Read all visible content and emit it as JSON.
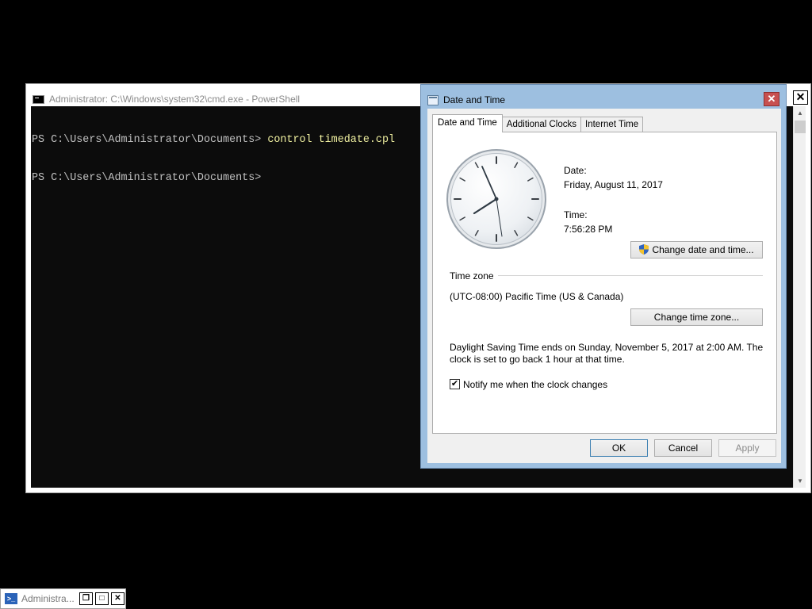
{
  "console": {
    "title": "Administrator: C:\\Windows\\system32\\cmd.exe - PowerShell",
    "lines": [
      {
        "prompt": "PS C:\\Users\\Administrator\\Documents> ",
        "command": "control timedate.cpl"
      },
      {
        "prompt": "PS C:\\Users\\Administrator\\Documents> ",
        "command": ""
      }
    ],
    "close_label": "✕"
  },
  "dialog": {
    "title": "Date and Time",
    "close_label": "✕",
    "tabs": [
      {
        "label": "Date and Time",
        "active": true
      },
      {
        "label": "Additional Clocks",
        "active": false
      },
      {
        "label": "Internet Time",
        "active": false
      }
    ],
    "date_label": "Date:",
    "date_value": "Friday, August 11, 2017",
    "time_label": "Time:",
    "time_value": "7:56:28 PM",
    "change_datetime_button": "Change date and time...",
    "timezone_heading": "Time zone",
    "timezone_value": "(UTC-08:00) Pacific Time (US & Canada)",
    "change_timezone_button": "Change time zone...",
    "dst_line1": "Daylight Saving Time ends on Sunday, November 5, 2017 at 2:00 AM. The",
    "dst_line2": "clock is set to go back 1 hour at that time.",
    "notify_label": "Notify me when the clock changes",
    "notify_checked": true,
    "ok_button": "OK",
    "cancel_button": "Cancel",
    "apply_button": "Apply"
  },
  "taskbar": {
    "label": "Administra...",
    "restore_icon": "restore-icon",
    "maximize_icon": "maximize-icon",
    "close_icon": "close-icon"
  },
  "colors": {
    "console_bg": "#0c0c0c",
    "console_text": "#c0c0c0",
    "dialog_frame": "#9dbfe0",
    "close_red": "#c75050"
  }
}
